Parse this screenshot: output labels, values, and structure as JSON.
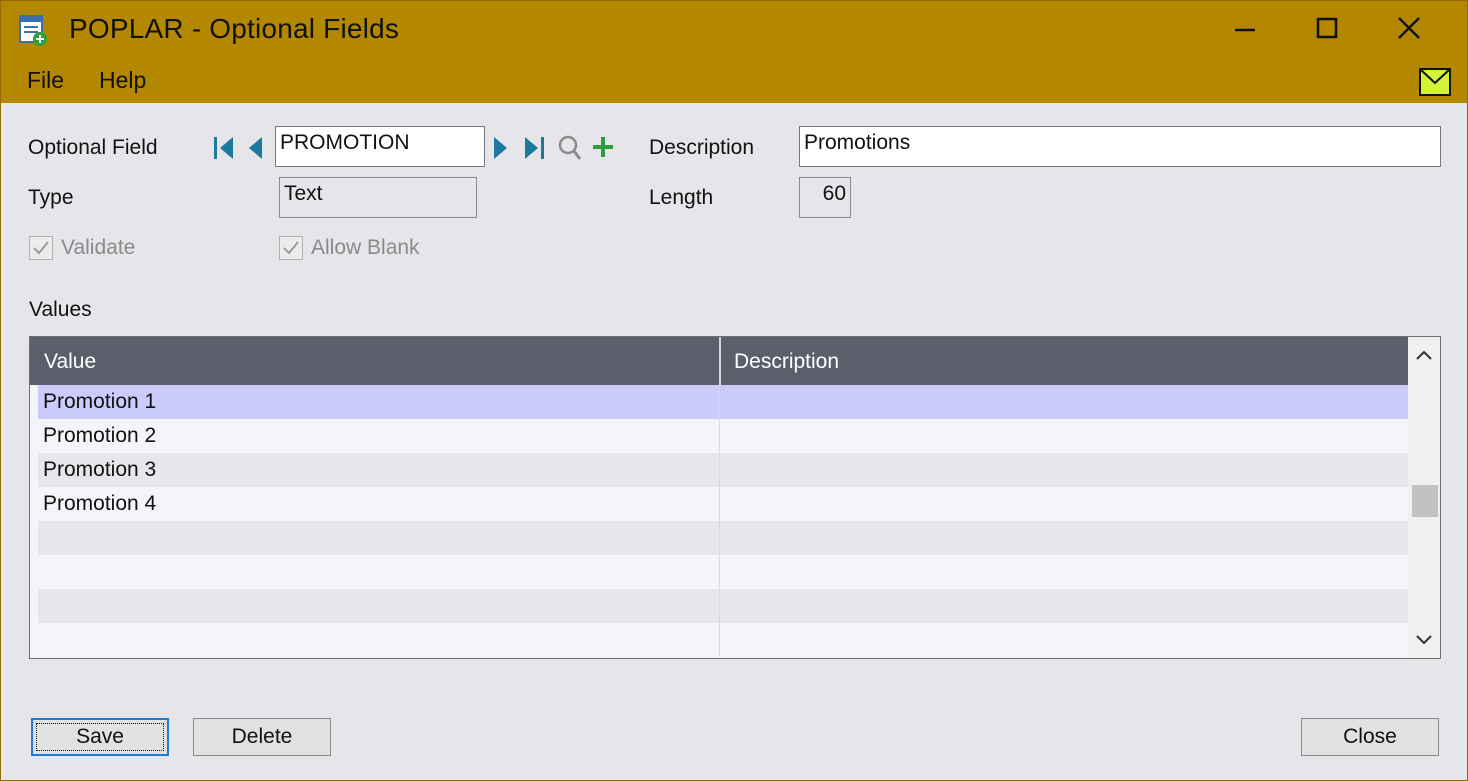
{
  "window": {
    "title": "POPLAR - Optional Fields",
    "minimize_icon": "minimize-icon",
    "maximize_icon": "maximize-icon",
    "close_icon": "close-icon",
    "colors": {
      "titlebar": "#b38800",
      "content": "#e6e6ea",
      "grid_header": "#5b5f6b",
      "selected_row": "#ccccfb"
    }
  },
  "menu": {
    "items": [
      "File",
      "Help"
    ]
  },
  "form": {
    "optional_field_label": "Optional Field",
    "optional_field_value": "PROMOTION",
    "description_label": "Description",
    "description_value": "Promotions",
    "type_label": "Type",
    "type_value": "Text",
    "length_label": "Length",
    "length_value": "60",
    "validate_label": "Validate",
    "validate_checked": true,
    "allow_blank_label": "Allow Blank",
    "allow_blank_checked": true,
    "values_label": "Values"
  },
  "grid": {
    "columns": [
      "Value",
      "Description"
    ],
    "rows": [
      {
        "value": "Promotion 1",
        "description": ""
      },
      {
        "value": "Promotion 2",
        "description": ""
      },
      {
        "value": "Promotion 3",
        "description": ""
      },
      {
        "value": "Promotion 4",
        "description": ""
      },
      {
        "value": "",
        "description": ""
      },
      {
        "value": "",
        "description": ""
      },
      {
        "value": "",
        "description": ""
      },
      {
        "value": "",
        "description": ""
      }
    ],
    "selected_row": 0
  },
  "buttons": {
    "save": "Save",
    "delete": "Delete",
    "close": "Close"
  }
}
